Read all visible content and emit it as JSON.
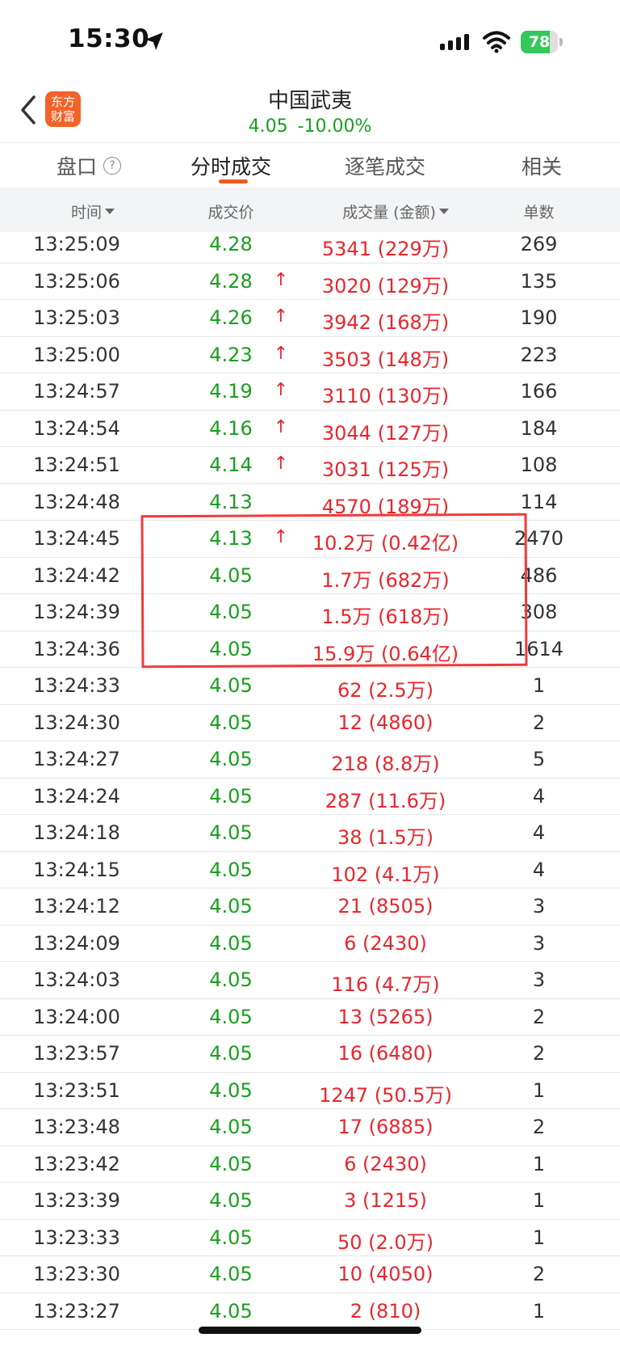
{
  "status_bar": {
    "time": "15:30",
    "battery": "78",
    "battery_level": 0.78
  },
  "header": {
    "title": "中国武夷",
    "price": "4.05",
    "change": "-10.00%",
    "logo_line1": "东方",
    "logo_line2": "财富"
  },
  "tabs": [
    {
      "label": "盘口",
      "active": false
    },
    {
      "label": "分时成交",
      "active": true
    },
    {
      "label": "逐笔成交",
      "active": false
    },
    {
      "label": "相关",
      "active": false
    }
  ],
  "columns": {
    "time": "时间",
    "price": "成交价",
    "volume": "成交量 (金额)",
    "count": "单数"
  },
  "rows": [
    {
      "time": "13:25:09",
      "price": "4.28",
      "arrow": "",
      "volume": "5341 (229万)",
      "count": "269"
    },
    {
      "time": "13:25:06",
      "price": "4.28",
      "arrow": "↑",
      "volume": "3020 (129万)",
      "count": "135"
    },
    {
      "time": "13:25:03",
      "price": "4.26",
      "arrow": "↑",
      "volume": "3942 (168万)",
      "count": "190"
    },
    {
      "time": "13:25:00",
      "price": "4.23",
      "arrow": "↑",
      "volume": "3503 (148万)",
      "count": "223"
    },
    {
      "time": "13:24:57",
      "price": "4.19",
      "arrow": "↑",
      "volume": "3110 (130万)",
      "count": "166"
    },
    {
      "time": "13:24:54",
      "price": "4.16",
      "arrow": "↑",
      "volume": "3044 (127万)",
      "count": "184"
    },
    {
      "time": "13:24:51",
      "price": "4.14",
      "arrow": "↑",
      "volume": "3031 (125万)",
      "count": "108"
    },
    {
      "time": "13:24:48",
      "price": "4.13",
      "arrow": "",
      "volume": "4570 (189万)",
      "count": "114"
    },
    {
      "time": "13:24:45",
      "price": "4.13",
      "arrow": "↑",
      "volume": "10.2万 (0.42亿)",
      "count": "2470"
    },
    {
      "time": "13:24:42",
      "price": "4.05",
      "arrow": "",
      "volume": "1.7万 (682万)",
      "count": "486"
    },
    {
      "time": "13:24:39",
      "price": "4.05",
      "arrow": "",
      "volume": "1.5万 (618万)",
      "count": "308"
    },
    {
      "time": "13:24:36",
      "price": "4.05",
      "arrow": "",
      "volume": "15.9万 (0.64亿)",
      "count": "1614"
    },
    {
      "time": "13:24:33",
      "price": "4.05",
      "arrow": "",
      "volume": "62 (2.5万)",
      "count": "1"
    },
    {
      "time": "13:24:30",
      "price": "4.05",
      "arrow": "",
      "volume": "12 (4860)",
      "count": "2"
    },
    {
      "time": "13:24:27",
      "price": "4.05",
      "arrow": "",
      "volume": "218 (8.8万)",
      "count": "5"
    },
    {
      "time": "13:24:24",
      "price": "4.05",
      "arrow": "",
      "volume": "287 (11.6万)",
      "count": "4"
    },
    {
      "time": "13:24:18",
      "price": "4.05",
      "arrow": "",
      "volume": "38 (1.5万)",
      "count": "4"
    },
    {
      "time": "13:24:15",
      "price": "4.05",
      "arrow": "",
      "volume": "102 (4.1万)",
      "count": "4"
    },
    {
      "time": "13:24:12",
      "price": "4.05",
      "arrow": "",
      "volume": "21 (8505)",
      "count": "3"
    },
    {
      "time": "13:24:09",
      "price": "4.05",
      "arrow": "",
      "volume": "6 (2430)",
      "count": "3"
    },
    {
      "time": "13:24:03",
      "price": "4.05",
      "arrow": "",
      "volume": "116 (4.7万)",
      "count": "3"
    },
    {
      "time": "13:24:00",
      "price": "4.05",
      "arrow": "",
      "volume": "13 (5265)",
      "count": "2"
    },
    {
      "time": "13:23:57",
      "price": "4.05",
      "arrow": "",
      "volume": "16 (6480)",
      "count": "2"
    },
    {
      "time": "13:23:51",
      "price": "4.05",
      "arrow": "",
      "volume": "1247 (50.5万)",
      "count": "1"
    },
    {
      "time": "13:23:48",
      "price": "4.05",
      "arrow": "",
      "volume": "17 (6885)",
      "count": "2"
    },
    {
      "time": "13:23:42",
      "price": "4.05",
      "arrow": "",
      "volume": "6 (2430)",
      "count": "1"
    },
    {
      "time": "13:23:39",
      "price": "4.05",
      "arrow": "",
      "volume": "3 (1215)",
      "count": "1"
    },
    {
      "time": "13:23:33",
      "price": "4.05",
      "arrow": "",
      "volume": "50 (2.0万)",
      "count": "1"
    },
    {
      "time": "13:23:30",
      "price": "4.05",
      "arrow": "",
      "volume": "10 (4050)",
      "count": "2"
    },
    {
      "time": "13:23:27",
      "price": "4.05",
      "arrow": "",
      "volume": "2 (810)",
      "count": "1"
    }
  ],
  "colors": {
    "up": "#e8262d",
    "down": "#1a9e1f",
    "accent": "#f05a22"
  }
}
